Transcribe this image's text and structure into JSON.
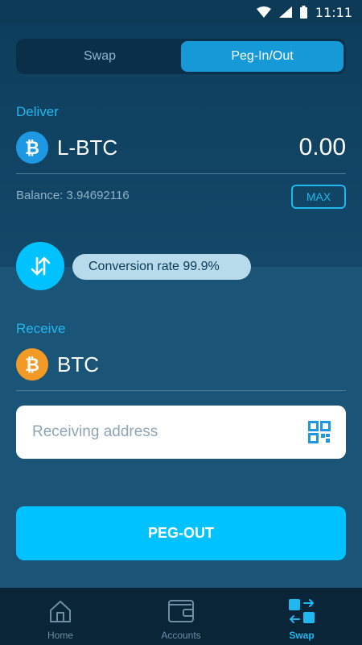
{
  "status_bar": {
    "time": "11:11"
  },
  "tabs": [
    {
      "label": "Swap",
      "active": false
    },
    {
      "label": "Peg-In/Out",
      "active": true
    }
  ],
  "deliver": {
    "label": "Deliver",
    "asset": "L-BTC",
    "amount": "0.00",
    "balance": "Balance: 3.94692116",
    "max_label": "MAX"
  },
  "conversion": {
    "rate_text": "Conversion rate 99.9%"
  },
  "receive": {
    "label": "Receive",
    "asset": "BTC",
    "address_placeholder": "Receiving address"
  },
  "action": {
    "label": "PEG-OUT"
  },
  "nav": [
    {
      "label": "Home",
      "icon": "home-icon",
      "active": false
    },
    {
      "label": "Accounts",
      "icon": "wallet-icon",
      "active": false
    },
    {
      "label": "Swap",
      "icon": "swap-icon",
      "active": true
    }
  ],
  "colors": {
    "accent": "#00c2ff",
    "label": "#21b8ef",
    "lbtc": "#1e98e2",
    "btc": "#f39a26",
    "background": "#1a5477"
  }
}
